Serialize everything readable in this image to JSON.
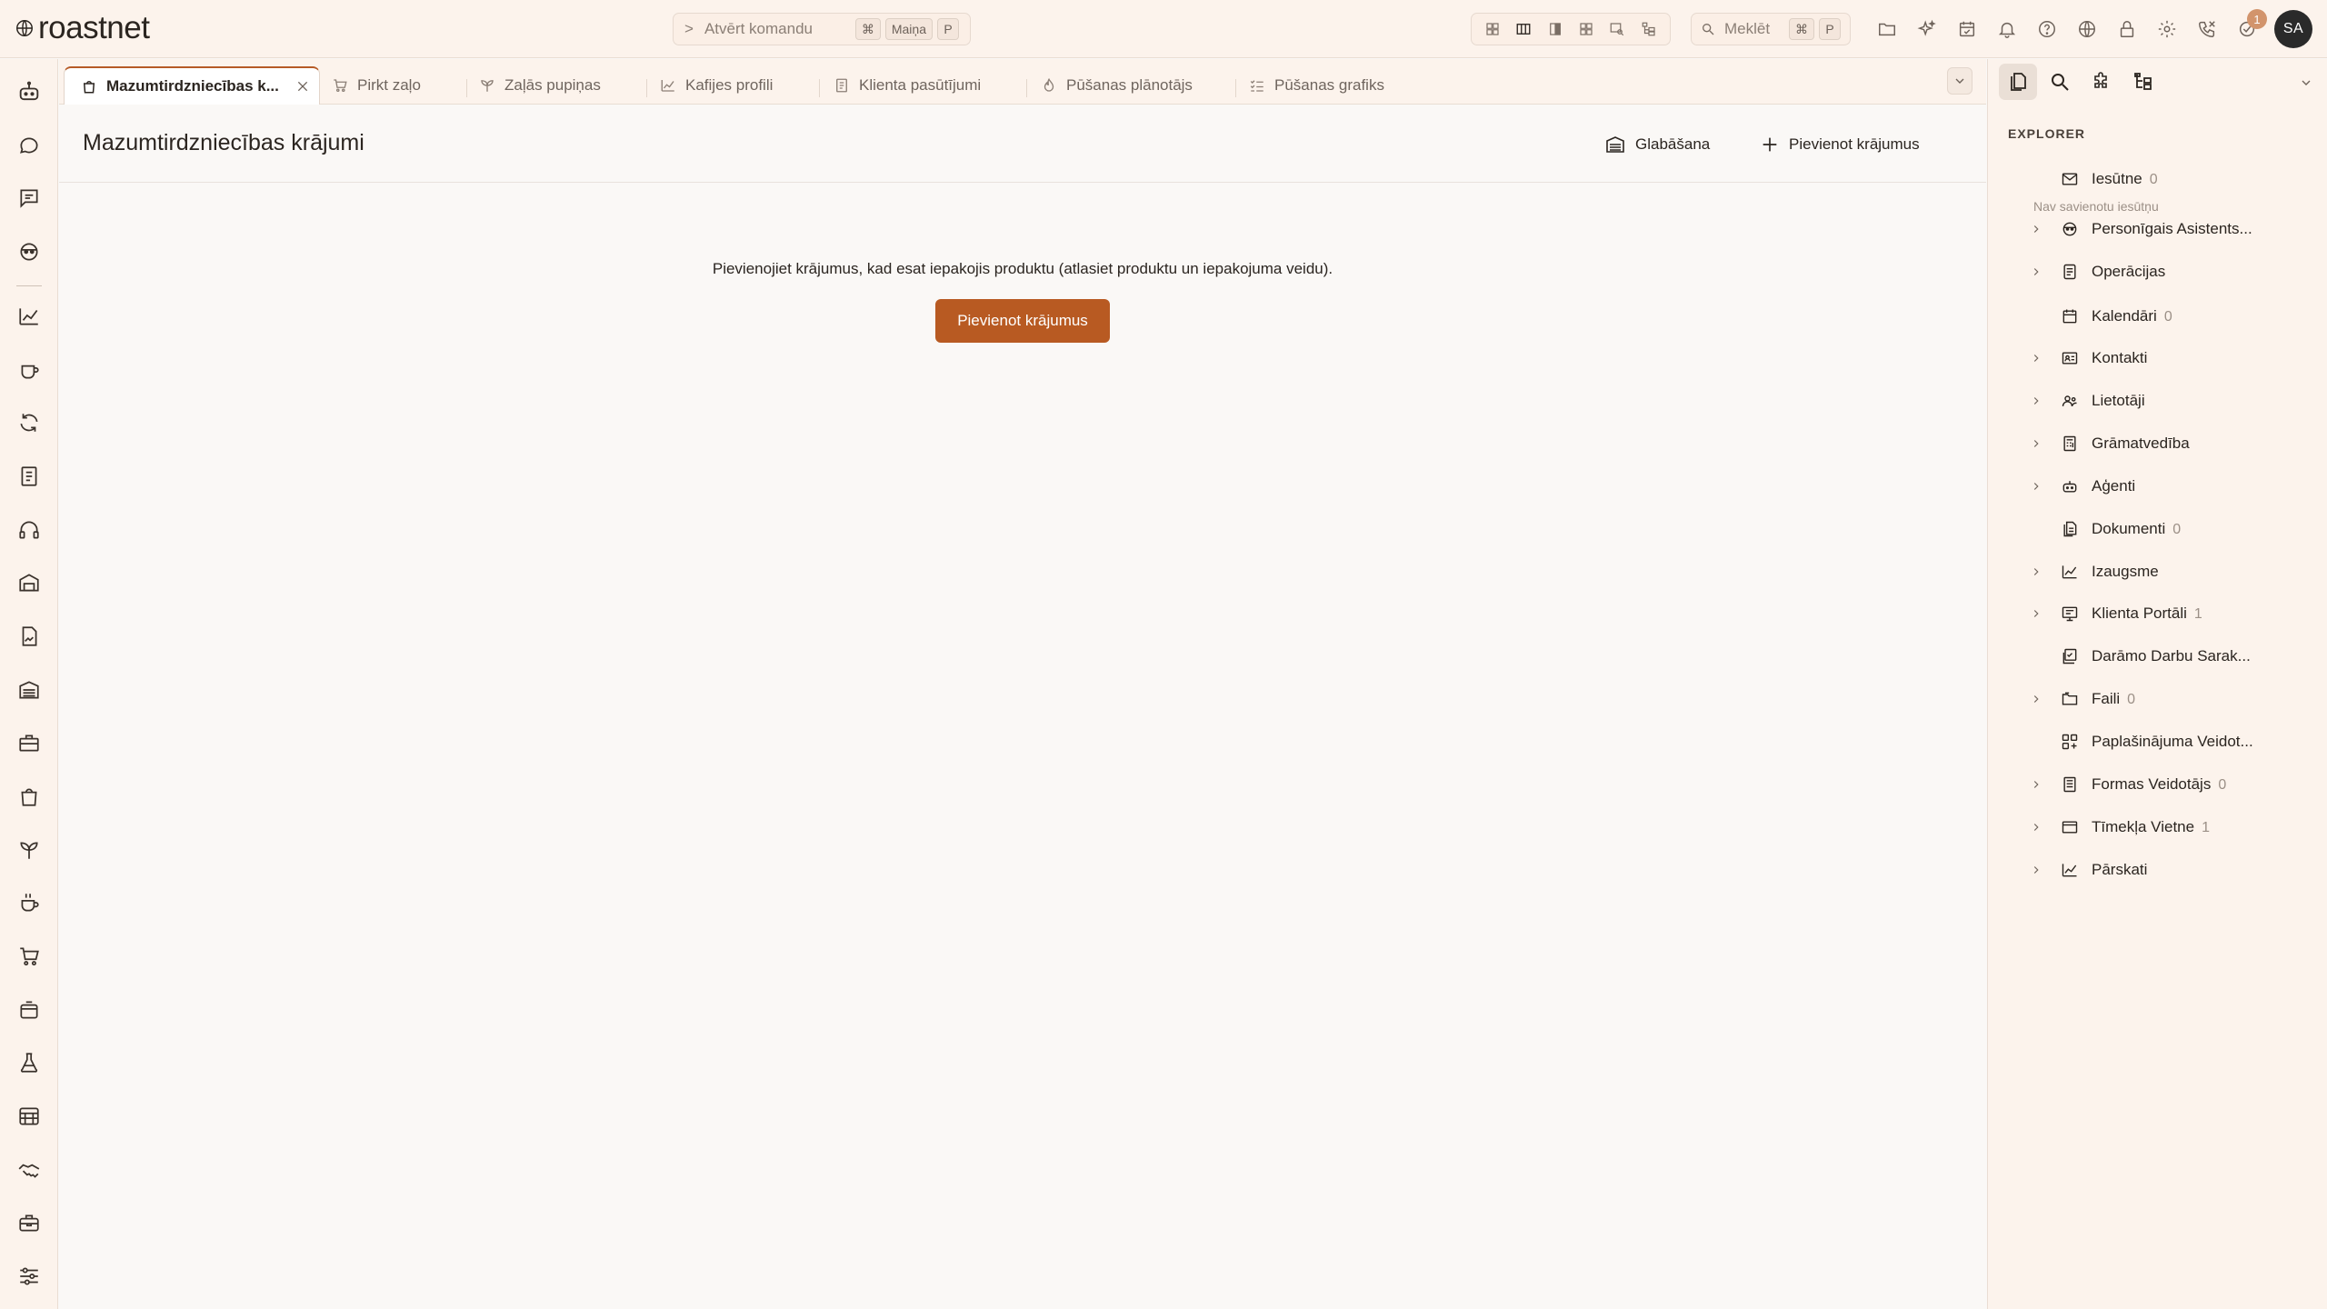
{
  "app": {
    "logo_text": "roastnet",
    "command": {
      "prompt": ">",
      "label": "Atvērt komandu",
      "keys": [
        "⌘",
        "Maiņa",
        "P"
      ]
    },
    "search": {
      "label": "Meklēt",
      "keys": [
        "⌘",
        "P"
      ]
    },
    "notification_count": "1",
    "avatar_initials": "SA"
  },
  "tabs": [
    {
      "label": "Mazumtirdzniecības k...",
      "icon": "bag-icon",
      "active": true
    },
    {
      "label": "Pirkt zaļo",
      "icon": "cart-icon"
    },
    {
      "label": "Zaļās pupiņas",
      "icon": "sprout-icon"
    },
    {
      "label": "Kafijes profili",
      "icon": "chart-line-icon"
    },
    {
      "label": "Klienta pasūtījumi",
      "icon": "document-icon"
    },
    {
      "label": "Pūšanas plānotājs",
      "icon": "flame-icon"
    },
    {
      "label": "Pūšanas grafiks",
      "icon": "checklist-icon"
    }
  ],
  "page": {
    "title": "Mazumtirdzniecības krājumi",
    "storage_label": "Glabāšana",
    "add_label": "Pievienot krājumus",
    "empty_text": "Pievienojiet krājumus, kad esat iepakojis produktu (atlasiet produktu un iepakojuma veidu).",
    "empty_button": "Pievienot krājumus"
  },
  "explorer": {
    "heading": "EXPLORER",
    "inbox_note": "Nav savienotu iesūtņu",
    "items": [
      {
        "label": "Iesūtne",
        "count": "0",
        "icon": "mail-icon",
        "expandable": false
      },
      {
        "label": "Personīgais Asistents...",
        "count": "",
        "icon": "assistant-icon",
        "expandable": true
      },
      {
        "label": "Operācijas",
        "count": "",
        "icon": "operations-icon",
        "expandable": true
      },
      {
        "label": "Kalendāri",
        "count": "0",
        "icon": "calendar-icon",
        "expandable": false
      },
      {
        "label": "Kontakti",
        "count": "",
        "icon": "contact-card-icon",
        "expandable": true
      },
      {
        "label": "Lietotāji",
        "count": "",
        "icon": "users-icon",
        "expandable": true
      },
      {
        "label": "Grāmatvedība",
        "count": "",
        "icon": "calculator-icon",
        "expandable": true
      },
      {
        "label": "Aģenti",
        "count": "",
        "icon": "robot-icon",
        "expandable": true
      },
      {
        "label": "Dokumenti",
        "count": "0",
        "icon": "documents-icon",
        "expandable": false
      },
      {
        "label": "Izaugsme",
        "count": "",
        "icon": "growth-icon",
        "expandable": true
      },
      {
        "label": "Klienta Portāli",
        "count": "1",
        "icon": "portal-icon",
        "expandable": true
      },
      {
        "label": "Darāmo Darbu Sarak...",
        "count": "",
        "icon": "todo-icon",
        "expandable": false
      },
      {
        "label": "Faili",
        "count": "0",
        "icon": "folder-icon",
        "expandable": true
      },
      {
        "label": "Paplašinājuma Veidot...",
        "count": "",
        "icon": "extension-icon",
        "expandable": false
      },
      {
        "label": "Formas Veidotājs",
        "count": "0",
        "icon": "form-icon",
        "expandable": true
      },
      {
        "label": "Tīmekļa Vietne",
        "count": "1",
        "icon": "website-icon",
        "expandable": true
      },
      {
        "label": "Pārskati",
        "count": "",
        "icon": "reports-icon",
        "expandable": true
      }
    ]
  },
  "colors": {
    "accent": "#b85a22",
    "topbar_bg": "#fcf3ec",
    "main_bg": "#faf8f6"
  }
}
